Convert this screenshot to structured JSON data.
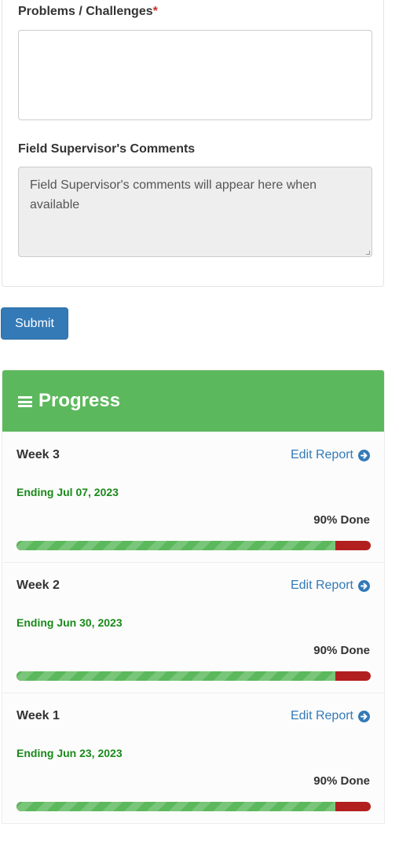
{
  "form": {
    "problems_label": "Problems / Challenges",
    "required_mark": "*",
    "problems_value": "",
    "supervisor_label": "Field Supervisor's Comments",
    "supervisor_placeholder": "Field Supervisor's comments will appear here when available"
  },
  "submit_label": "Submit",
  "progress": {
    "title": "Progress",
    "header_icon": "list-icon",
    "header_color": "#5cb85c",
    "done_color": "#5cb85c",
    "remaining_color": "#b21f1f",
    "weeks": [
      {
        "title": "Week 3",
        "edit_label": "Edit Report",
        "ending": "Ending Jul 07, 2023",
        "done_label": "90% Done",
        "percent": 90
      },
      {
        "title": "Week 2",
        "edit_label": "Edit Report",
        "ending": "Ending Jun 30, 2023",
        "done_label": "90% Done",
        "percent": 90
      },
      {
        "title": "Week 1",
        "edit_label": "Edit Report",
        "ending": "Ending Jun 23, 2023",
        "done_label": "90% Done",
        "percent": 90
      }
    ]
  }
}
